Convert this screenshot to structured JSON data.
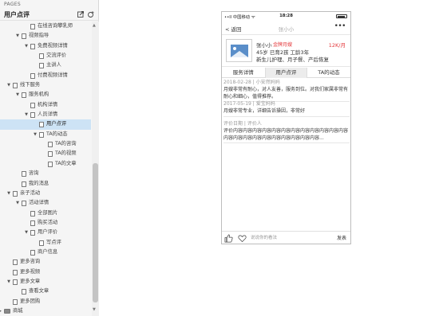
{
  "sidebar": {
    "section_label": "PAGES",
    "title": "用户点评",
    "icons": [
      "export-icon",
      "add-page-icon"
    ],
    "tree": [
      {
        "label": "在线咨询攀乳师",
        "arrow": "",
        "type": "page",
        "level": 4
      },
      {
        "label": "视频指导",
        "arrow": "▼",
        "type": "page",
        "level": 3
      },
      {
        "label": "免费视频详情",
        "arrow": "▼",
        "type": "page",
        "level": 4
      },
      {
        "label": "交流评价",
        "arrow": "",
        "type": "page",
        "level": 5
      },
      {
        "label": "主讲人",
        "arrow": "",
        "type": "page",
        "level": 5
      },
      {
        "label": "付费视频详情",
        "arrow": "",
        "type": "page",
        "level": 4
      },
      {
        "label": "线下服务",
        "arrow": "▼",
        "type": "page",
        "level": 2
      },
      {
        "label": "服务机构",
        "arrow": "▼",
        "type": "page",
        "level": 3
      },
      {
        "label": "机构详情",
        "arrow": "",
        "type": "page",
        "level": 4
      },
      {
        "label": "人员详情",
        "arrow": "▼",
        "type": "page",
        "level": 4
      },
      {
        "label": "用户点评",
        "arrow": "",
        "type": "page",
        "level": 5,
        "selected": true
      },
      {
        "label": "TA的动态",
        "arrow": "▼",
        "type": "page",
        "level": 5
      },
      {
        "label": "TA的咨询",
        "arrow": "",
        "type": "page",
        "level": 6
      },
      {
        "label": "TA的视频",
        "arrow": "",
        "type": "page",
        "level": 6
      },
      {
        "label": "TA的文章",
        "arrow": "",
        "type": "page",
        "level": 6
      },
      {
        "label": "咨询",
        "arrow": "",
        "type": "page",
        "level": 3
      },
      {
        "label": "我的消息",
        "arrow": "",
        "type": "page",
        "level": 3
      },
      {
        "label": "亲子活动",
        "arrow": "▼",
        "type": "page",
        "level": 2
      },
      {
        "label": "活动详情",
        "arrow": "▼",
        "type": "page",
        "level": 3
      },
      {
        "label": "全部图片",
        "arrow": "",
        "type": "page",
        "level": 4
      },
      {
        "label": "购买活动",
        "arrow": "",
        "type": "page",
        "level": 4
      },
      {
        "label": "用户评价",
        "arrow": "▼",
        "type": "page",
        "level": 4
      },
      {
        "label": "写点评",
        "arrow": "",
        "type": "page",
        "level": 5
      },
      {
        "label": "商户信息",
        "arrow": "",
        "type": "page",
        "level": 4
      },
      {
        "label": "更多咨询",
        "arrow": "",
        "type": "page",
        "level": 2
      },
      {
        "label": "更多视频",
        "arrow": "",
        "type": "page",
        "level": 2
      },
      {
        "label": "更多文章",
        "arrow": "▼",
        "type": "page",
        "level": 2
      },
      {
        "label": "查看文章",
        "arrow": "",
        "type": "page",
        "level": 3
      },
      {
        "label": "更多团购",
        "arrow": "",
        "type": "page",
        "level": 2
      },
      {
        "label": "商城",
        "arrow": "▶",
        "type": "folder",
        "level": 1
      }
    ]
  },
  "phone": {
    "status": {
      "carrier": "••ll 中国移动 ᯤ",
      "time": "18:28"
    },
    "nav": {
      "back": "< 返回",
      "title": "张小小",
      "more": "•••"
    },
    "profile": {
      "name": "张小小",
      "badge": "金牌月嫂",
      "price": "12K/月",
      "line2": "45岁  已育2孩  工龄3年",
      "line3": "新生儿护理、月子餐、产后恢复"
    },
    "tabs": [
      "服务详情",
      "用户点评",
      "TA的动态"
    ],
    "active_tab": 1,
    "reviews": [
      {
        "meta": "2018-02-28 | 小安然妈妈",
        "body": "月嫂非常有耐心，对人友善，服务到位。对我们家属非常有耐心和细心，值得推荐。"
      },
      {
        "meta": "2017-05-19 | 爱宝妈妈",
        "body": "月嫂非常专业，详细告诉操因，非常好"
      },
      {
        "meta": "评价日期 | 评价人",
        "body": "评价内容内容内容内容内容内容内容内容内容内容内容内容内容内容内容内容内容内容内容内容内容内容..."
      }
    ],
    "bottom": {
      "input_placeholder": "说说你的看法",
      "send": "发表",
      "icons": [
        "like-icon",
        "favorite-icon"
      ]
    }
  }
}
